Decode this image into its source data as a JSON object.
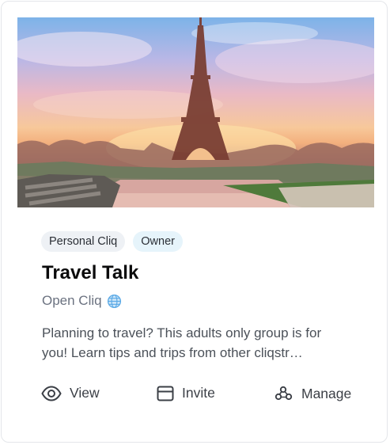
{
  "card": {
    "image_alt": "Eiffel Tower at sunset",
    "tags": [
      "Personal Cliq",
      "Owner"
    ],
    "title": "Travel Talk",
    "privacy": {
      "label": "Open Cliq",
      "icon": "globe-icon"
    },
    "description": "Planning to travel? This adults only group is for you! Learn tips and trips from other cliqstr…",
    "actions": [
      {
        "label": "View",
        "icon": "eye-icon"
      },
      {
        "label": "Invite",
        "icon": "card-icon"
      },
      {
        "label": "Manage",
        "icon": "manage-icon"
      }
    ]
  },
  "colors": {
    "tag_grey_bg": "#eef1f5",
    "tag_blue_bg": "#e6f4fb",
    "globe_blue": "#5aa9e6",
    "text_primary": "#0b0b0c",
    "text_secondary": "#6b7280"
  }
}
